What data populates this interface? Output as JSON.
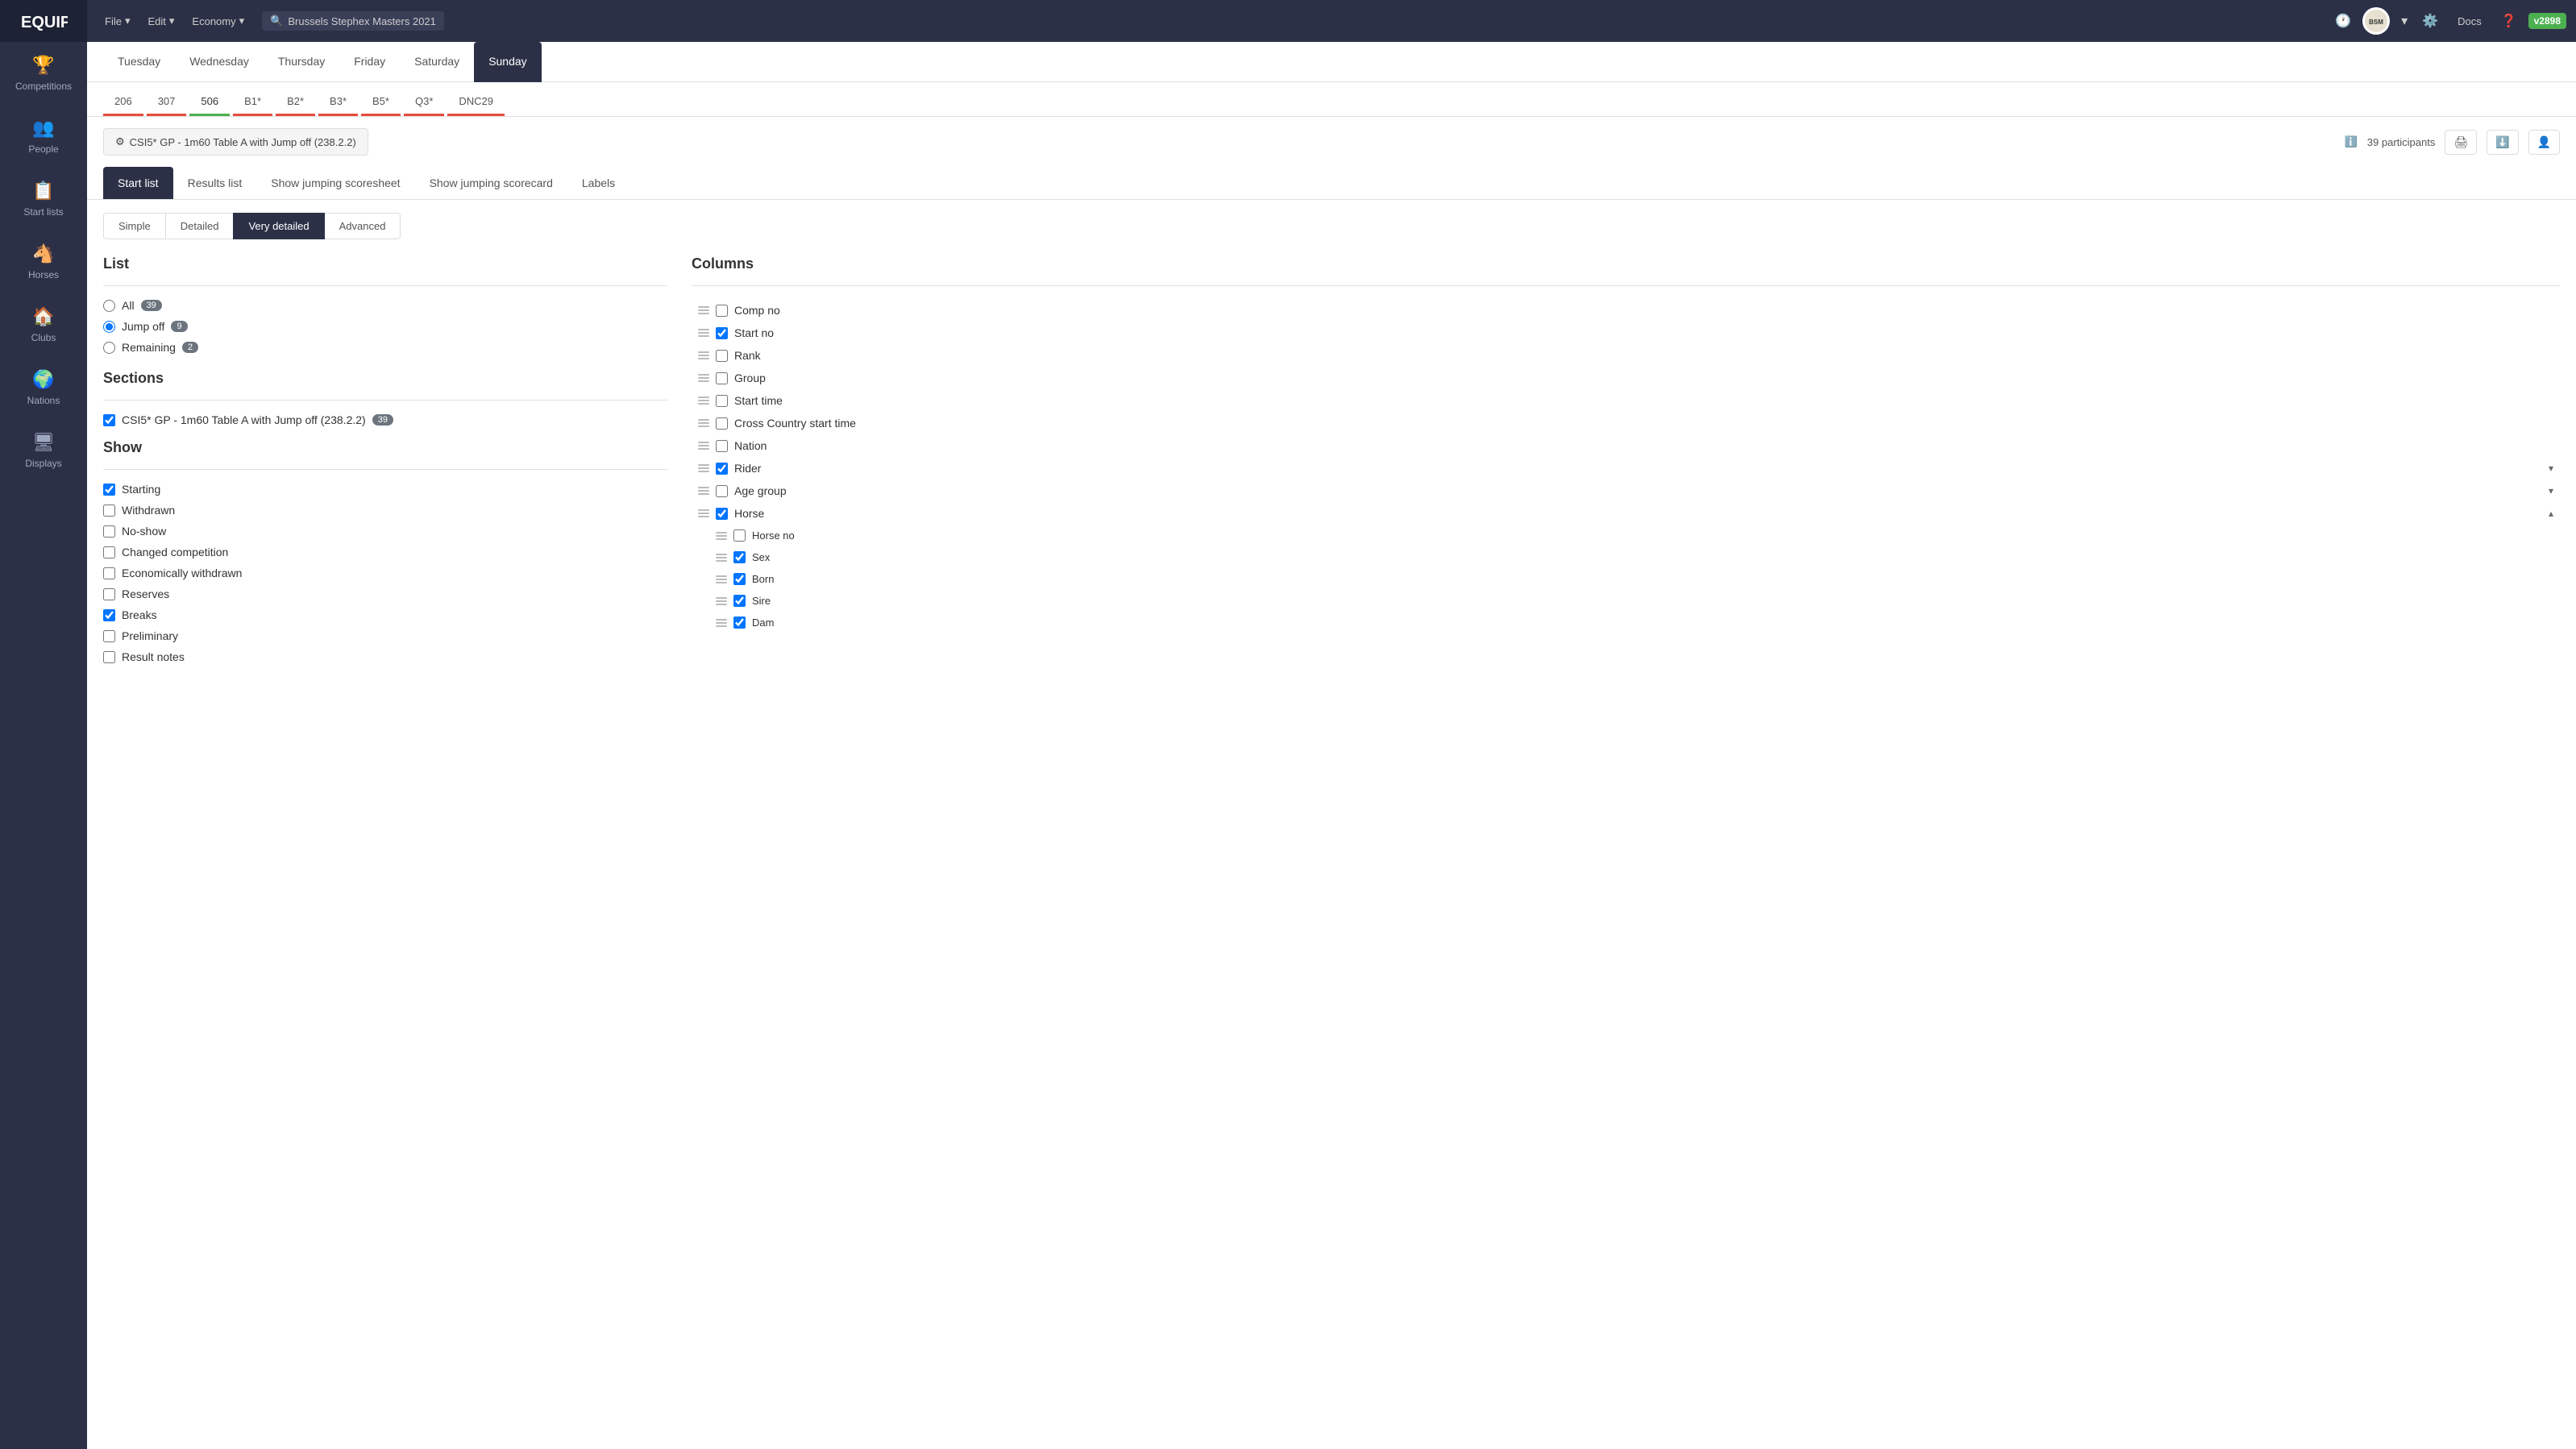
{
  "app": {
    "logo": "EQUIPE",
    "version": "v2898",
    "search_placeholder": "Brussels Stephex Masters 2021"
  },
  "topbar": {
    "menu_items": [
      "File",
      "Edit",
      "Economy"
    ],
    "icons": [
      "history",
      "settings",
      "docs",
      "help"
    ]
  },
  "sidebar": {
    "items": [
      {
        "id": "competitions",
        "label": "Competitions",
        "icon": "🏆"
      },
      {
        "id": "people",
        "label": "People",
        "icon": "👥"
      },
      {
        "id": "start-lists",
        "label": "Start lists",
        "icon": "📋"
      },
      {
        "id": "horses",
        "label": "Horses",
        "icon": "🐴"
      },
      {
        "id": "clubs",
        "label": "Clubs",
        "icon": "🏠"
      },
      {
        "id": "nations",
        "label": "Nations",
        "icon": "🌍"
      },
      {
        "id": "displays",
        "label": "Displays",
        "icon": "🖥"
      }
    ]
  },
  "day_tabs": [
    "Tuesday",
    "Wednesday",
    "Thursday",
    "Friday",
    "Saturday",
    "Sunday"
  ],
  "active_day": "Sunday",
  "class_tabs": [
    {
      "id": "206",
      "label": "206",
      "color": "red"
    },
    {
      "id": "307",
      "label": "307",
      "color": "red"
    },
    {
      "id": "506",
      "label": "506",
      "color": "green",
      "active": true
    },
    {
      "id": "B1*",
      "label": "B1*",
      "color": "red"
    },
    {
      "id": "B2*",
      "label": "B2*",
      "color": "red"
    },
    {
      "id": "B3*",
      "label": "B3*",
      "color": "red"
    },
    {
      "id": "B5*",
      "label": "B5*",
      "color": "red"
    },
    {
      "id": "Q3*",
      "label": "Q3*",
      "color": "red"
    },
    {
      "id": "DNC29",
      "label": "DNC29",
      "color": "red"
    }
  ],
  "competition": {
    "label": "CSI5* GP - 1m60 Table A with Jump off (238.2.2)",
    "participants_count": "39 participants"
  },
  "view_tabs": [
    "Start list",
    "Results list",
    "Show jumping scoresheet",
    "Show jumping scorecard",
    "Labels"
  ],
  "active_view": "Start list",
  "detail_tabs": [
    "Simple",
    "Detailed",
    "Very detailed",
    "Advanced"
  ],
  "active_detail": "Very detailed",
  "list_section": {
    "title": "List",
    "filters": [
      {
        "id": "all",
        "label": "All",
        "count": 39,
        "checked": false
      },
      {
        "id": "jump-off",
        "label": "Jump off",
        "count": 9,
        "checked": true
      },
      {
        "id": "remaining",
        "label": "Remaining",
        "count": 2,
        "checked": false
      }
    ]
  },
  "sections_section": {
    "title": "Sections",
    "items": [
      {
        "label": "CSI5* GP - 1m60 Table A with Jump off (238.2.2)",
        "count": 39,
        "checked": true
      }
    ]
  },
  "show_section": {
    "title": "Show",
    "items": [
      {
        "id": "starting",
        "label": "Starting",
        "checked": true
      },
      {
        "id": "withdrawn",
        "label": "Withdrawn",
        "checked": false
      },
      {
        "id": "no-show",
        "label": "No-show",
        "checked": false
      },
      {
        "id": "changed-competition",
        "label": "Changed competition",
        "checked": false
      },
      {
        "id": "economically-withdrawn",
        "label": "Economically withdrawn",
        "checked": false
      },
      {
        "id": "reserves",
        "label": "Reserves",
        "checked": false
      },
      {
        "id": "breaks",
        "label": "Breaks",
        "checked": true
      },
      {
        "id": "preliminary",
        "label": "Preliminary",
        "checked": false
      },
      {
        "id": "result-notes",
        "label": "Result notes",
        "checked": false
      }
    ]
  },
  "columns_section": {
    "title": "Columns",
    "items": [
      {
        "id": "comp-no",
        "label": "Comp no",
        "checked": false,
        "expandable": false,
        "children": []
      },
      {
        "id": "start-no",
        "label": "Start no",
        "checked": true,
        "expandable": false,
        "children": []
      },
      {
        "id": "rank",
        "label": "Rank",
        "checked": false,
        "expandable": false,
        "children": []
      },
      {
        "id": "group",
        "label": "Group",
        "checked": false,
        "expandable": false,
        "children": []
      },
      {
        "id": "start-time",
        "label": "Start time",
        "checked": false,
        "expandable": false,
        "children": []
      },
      {
        "id": "cross-country-start-time",
        "label": "Cross Country start time",
        "checked": false,
        "expandable": false,
        "children": []
      },
      {
        "id": "nation",
        "label": "Nation",
        "checked": false,
        "expandable": false,
        "children": []
      },
      {
        "id": "rider",
        "label": "Rider",
        "checked": true,
        "expandable": true,
        "expanded": false
      },
      {
        "id": "age-group",
        "label": "Age group",
        "checked": false,
        "expandable": true,
        "expanded": false
      },
      {
        "id": "horse",
        "label": "Horse",
        "checked": true,
        "expandable": true,
        "expanded": true,
        "children": [
          {
            "id": "horse-no",
            "label": "Horse no",
            "checked": false
          },
          {
            "id": "sex",
            "label": "Sex",
            "checked": true
          },
          {
            "id": "born",
            "label": "Born",
            "checked": true
          },
          {
            "id": "sire",
            "label": "Sire",
            "checked": true
          },
          {
            "id": "dam",
            "label": "Dam",
            "checked": true
          }
        ]
      }
    ]
  }
}
